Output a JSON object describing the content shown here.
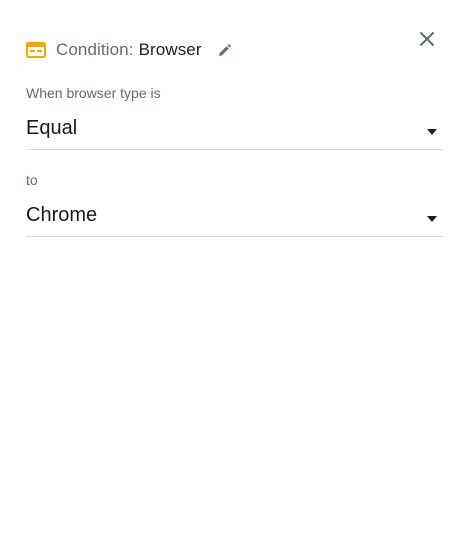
{
  "header": {
    "title_prefix": "Condition:",
    "title_value": "Browser",
    "icon": "browser-window-icon",
    "accent_color": "#f2a900"
  },
  "actions": {
    "edit_icon": "pencil-icon",
    "close_icon": "close-icon"
  },
  "fields": [
    {
      "label": "When browser type is",
      "value": "Equal"
    },
    {
      "label": "to",
      "value": "Chrome"
    }
  ]
}
